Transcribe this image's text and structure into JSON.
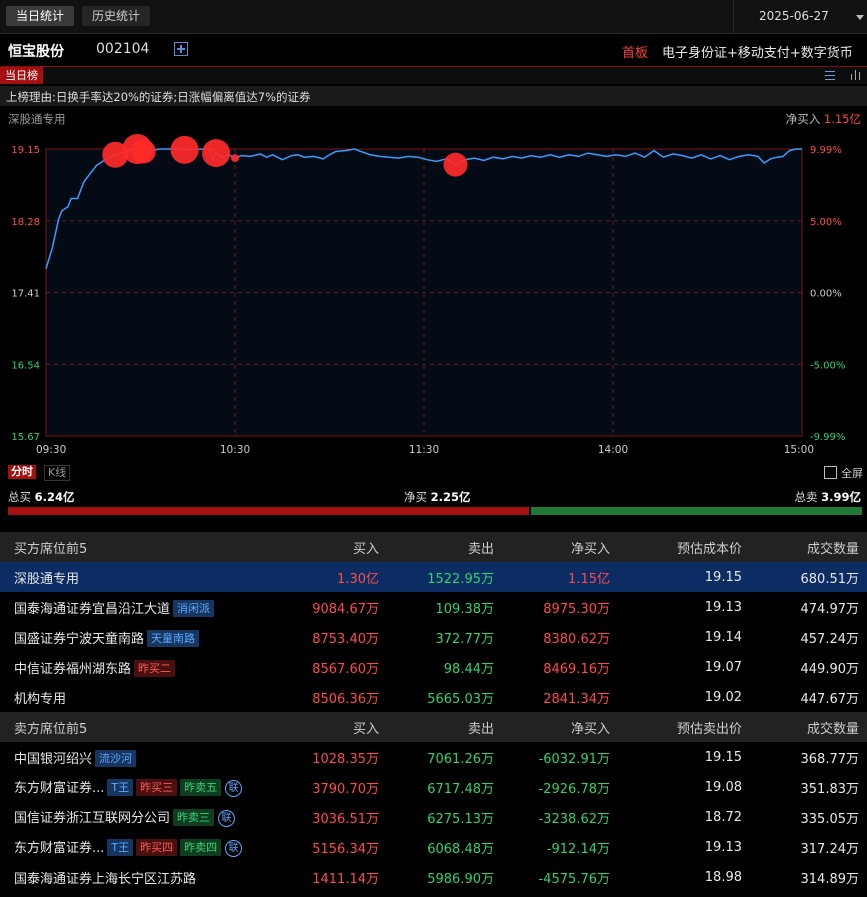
{
  "tabs": {
    "today": "当日统计",
    "history": "历史统计"
  },
  "date": "2025-06-27",
  "stock": {
    "name": "恒宝股份",
    "code": "002104",
    "board": "首板",
    "concept": "电子身份证+移动支付+数字货币"
  },
  "list_tag": "当日榜",
  "reason": "上榜理由:日换手率达20%的证券;日涨幅偏离值达7%的证券",
  "chart_header": {
    "label": "深股通专用",
    "net_buy_label": "净买入",
    "net_buy_value": "1.15亿"
  },
  "chart_data": {
    "type": "line",
    "y_ticks": [
      "19.15",
      "18.28",
      "17.41",
      "16.54",
      "15.67"
    ],
    "y_tick_values": [
      19.15,
      18.28,
      17.41,
      16.54,
      15.67
    ],
    "pct_ticks": [
      "9.99%",
      "5.00%",
      "0.00%",
      "-5.00%",
      "-9.99%"
    ],
    "x_ticks": [
      "09:30",
      "10:30",
      "11:30",
      "14:00",
      "15:00"
    ],
    "ylim": [
      15.67,
      19.15
    ],
    "points_minute_price": [
      [
        0,
        17.7
      ],
      [
        2,
        17.95
      ],
      [
        4,
        18.3
      ],
      [
        5,
        18.4
      ],
      [
        7,
        18.45
      ],
      [
        8,
        18.55
      ],
      [
        10,
        18.55
      ],
      [
        12,
        18.75
      ],
      [
        14,
        18.85
      ],
      [
        16,
        18.95
      ],
      [
        18,
        19.0
      ],
      [
        20,
        19.05
      ],
      [
        22,
        19.08
      ],
      [
        25,
        19.12
      ],
      [
        28,
        19.15
      ],
      [
        32,
        19.12
      ],
      [
        36,
        19.15
      ],
      [
        40,
        19.15
      ],
      [
        45,
        19.14
      ],
      [
        50,
        19.15
      ],
      [
        52,
        19.15
      ],
      [
        53,
        19.02
      ],
      [
        54,
        19.1
      ],
      [
        56,
        19.05
      ],
      [
        58,
        19.08
      ],
      [
        60,
        19.04
      ],
      [
        62,
        19.07
      ],
      [
        65,
        19.06
      ],
      [
        68,
        19.09
      ],
      [
        70,
        19.05
      ],
      [
        72,
        19.08
      ],
      [
        75,
        19.02
      ],
      [
        78,
        19.07
      ],
      [
        80,
        19.08
      ],
      [
        82,
        19.05
      ],
      [
        85,
        19.06
      ],
      [
        88,
        19.03
      ],
      [
        90,
        19.08
      ],
      [
        92,
        19.12
      ],
      [
        95,
        19.13
      ],
      [
        98,
        19.15
      ],
      [
        100,
        19.12
      ],
      [
        103,
        19.08
      ],
      [
        106,
        19.06
      ],
      [
        109,
        19.05
      ],
      [
        112,
        19.04
      ],
      [
        115,
        19.06
      ],
      [
        118,
        19.05
      ],
      [
        121,
        19.02
      ],
      [
        124,
        19.0
      ],
      [
        127,
        19.03
      ],
      [
        130,
        18.96
      ],
      [
        133,
        19.02
      ],
      [
        136,
        19.04
      ],
      [
        139,
        19.01
      ],
      [
        142,
        19.05
      ],
      [
        145,
        19.03
      ],
      [
        148,
        19.06
      ],
      [
        151,
        19.04
      ],
      [
        154,
        19.07
      ],
      [
        157,
        19.05
      ],
      [
        160,
        19.08
      ],
      [
        163,
        19.05
      ],
      [
        166,
        19.08
      ],
      [
        169,
        19.06
      ],
      [
        172,
        19.1
      ],
      [
        175,
        19.08
      ],
      [
        178,
        19.06
      ],
      [
        181,
        19.08
      ],
      [
        184,
        19.06
      ],
      [
        187,
        19.1
      ],
      [
        190,
        19.05
      ],
      [
        193,
        19.13
      ],
      [
        196,
        19.05
      ],
      [
        199,
        19.09
      ],
      [
        202,
        19.07
      ],
      [
        205,
        19.04
      ],
      [
        208,
        19.08
      ],
      [
        211,
        19.03
      ],
      [
        214,
        19.07
      ],
      [
        217,
        19.02
      ],
      [
        220,
        19.06
      ],
      [
        223,
        19.08
      ],
      [
        226,
        19.06
      ],
      [
        228,
        18.98
      ],
      [
        230,
        19.03
      ],
      [
        232,
        19.05
      ],
      [
        234,
        19.06
      ],
      [
        236,
        19.13
      ],
      [
        238,
        19.15
      ],
      [
        240,
        19.15
      ]
    ],
    "bubbles_minute_size": [
      [
        22,
        13
      ],
      [
        29,
        15
      ],
      [
        31,
        12
      ],
      [
        44,
        14
      ],
      [
        54,
        14
      ],
      [
        60,
        4
      ],
      [
        130,
        12
      ]
    ]
  },
  "period_tabs": {
    "fenshi": "分时",
    "kline": "K线"
  },
  "fullscreen": "全屏",
  "summary": {
    "total_buy_label": "总买",
    "total_buy": "6.24亿",
    "net_buy_label": "净买",
    "net_buy": "2.25亿",
    "total_sell_label": "总卖",
    "total_sell": "3.99亿",
    "buy_share": 0.61
  },
  "buy_table": {
    "headers": [
      "买方席位前5",
      "买入",
      "卖出",
      "净买入",
      "预估成本价",
      "成交数量"
    ],
    "rows": [
      {
        "name": "深股通专用",
        "tags": [],
        "link": false,
        "buy": "1.30亿",
        "sell": "1522.95万",
        "net": "1.15亿",
        "price": "19.15",
        "volume": "680.51万",
        "highlight": true
      },
      {
        "name": "国泰海通证券宜昌沿江大道",
        "tags": [
          {
            "text": "消闲派",
            "color": "blue"
          }
        ],
        "link": false,
        "buy": "9084.67万",
        "sell": "109.38万",
        "net": "8975.30万",
        "price": "19.13",
        "volume": "474.97万"
      },
      {
        "name": "国盛证券宁波天童南路",
        "tags": [
          {
            "text": "天童南路",
            "color": "blue"
          }
        ],
        "link": false,
        "buy": "8753.40万",
        "sell": "372.77万",
        "net": "8380.62万",
        "price": "19.14",
        "volume": "457.24万"
      },
      {
        "name": "中信证券福州湖东路",
        "tags": [
          {
            "text": "昨买二",
            "color": "red"
          }
        ],
        "link": false,
        "buy": "8567.60万",
        "sell": "98.44万",
        "net": "8469.16万",
        "price": "19.07",
        "volume": "449.90万"
      },
      {
        "name": "机构专用",
        "tags": [],
        "link": false,
        "buy": "8506.36万",
        "sell": "5665.03万",
        "net": "2841.34万",
        "price": "19.02",
        "volume": "447.67万"
      }
    ]
  },
  "sell_table": {
    "headers": [
      "卖方席位前5",
      "买入",
      "卖出",
      "净买入",
      "预估卖出价",
      "成交数量"
    ],
    "rows": [
      {
        "name": "中国银河绍兴",
        "tags": [
          {
            "text": "流沙河",
            "color": "blue"
          }
        ],
        "link": false,
        "buy": "1028.35万",
        "sell": "7061.26万",
        "net": "-6032.91万",
        "price": "19.15",
        "volume": "368.77万"
      },
      {
        "name": "东方财富证券...",
        "tags": [
          {
            "text": "T王",
            "color": "blue"
          },
          {
            "text": "昨买三",
            "color": "red"
          },
          {
            "text": "昨卖五",
            "color": "green"
          }
        ],
        "link": true,
        "link_text": "联",
        "buy": "3790.70万",
        "sell": "6717.48万",
        "net": "-2926.78万",
        "price": "19.08",
        "volume": "351.83万"
      },
      {
        "name": "国信证券浙江互联网分公司",
        "tags": [
          {
            "text": "昨卖三",
            "color": "green"
          }
        ],
        "link": true,
        "link_text": "联",
        "buy": "3036.51万",
        "sell": "6275.13万",
        "net": "-3238.62万",
        "price": "18.72",
        "volume": "335.05万"
      },
      {
        "name": "东方财富证券...",
        "tags": [
          {
            "text": "T王",
            "color": "blue"
          },
          {
            "text": "昨买四",
            "color": "red"
          },
          {
            "text": "昨卖四",
            "color": "green"
          }
        ],
        "link": true,
        "link_text": "联",
        "buy": "5156.34万",
        "sell": "6068.48万",
        "net": "-912.14万",
        "price": "19.13",
        "volume": "317.24万"
      },
      {
        "name": "国泰海通证券上海长宁区江苏路",
        "tags": [],
        "link": false,
        "buy": "1411.14万",
        "sell": "5986.90万",
        "net": "-4575.76万",
        "price": "18.98",
        "volume": "314.89万"
      }
    ]
  },
  "colors": {
    "up": "#ff4a4a",
    "down": "#2ed36b",
    "line": "#3a9cff",
    "accent": "#a50f0f"
  }
}
